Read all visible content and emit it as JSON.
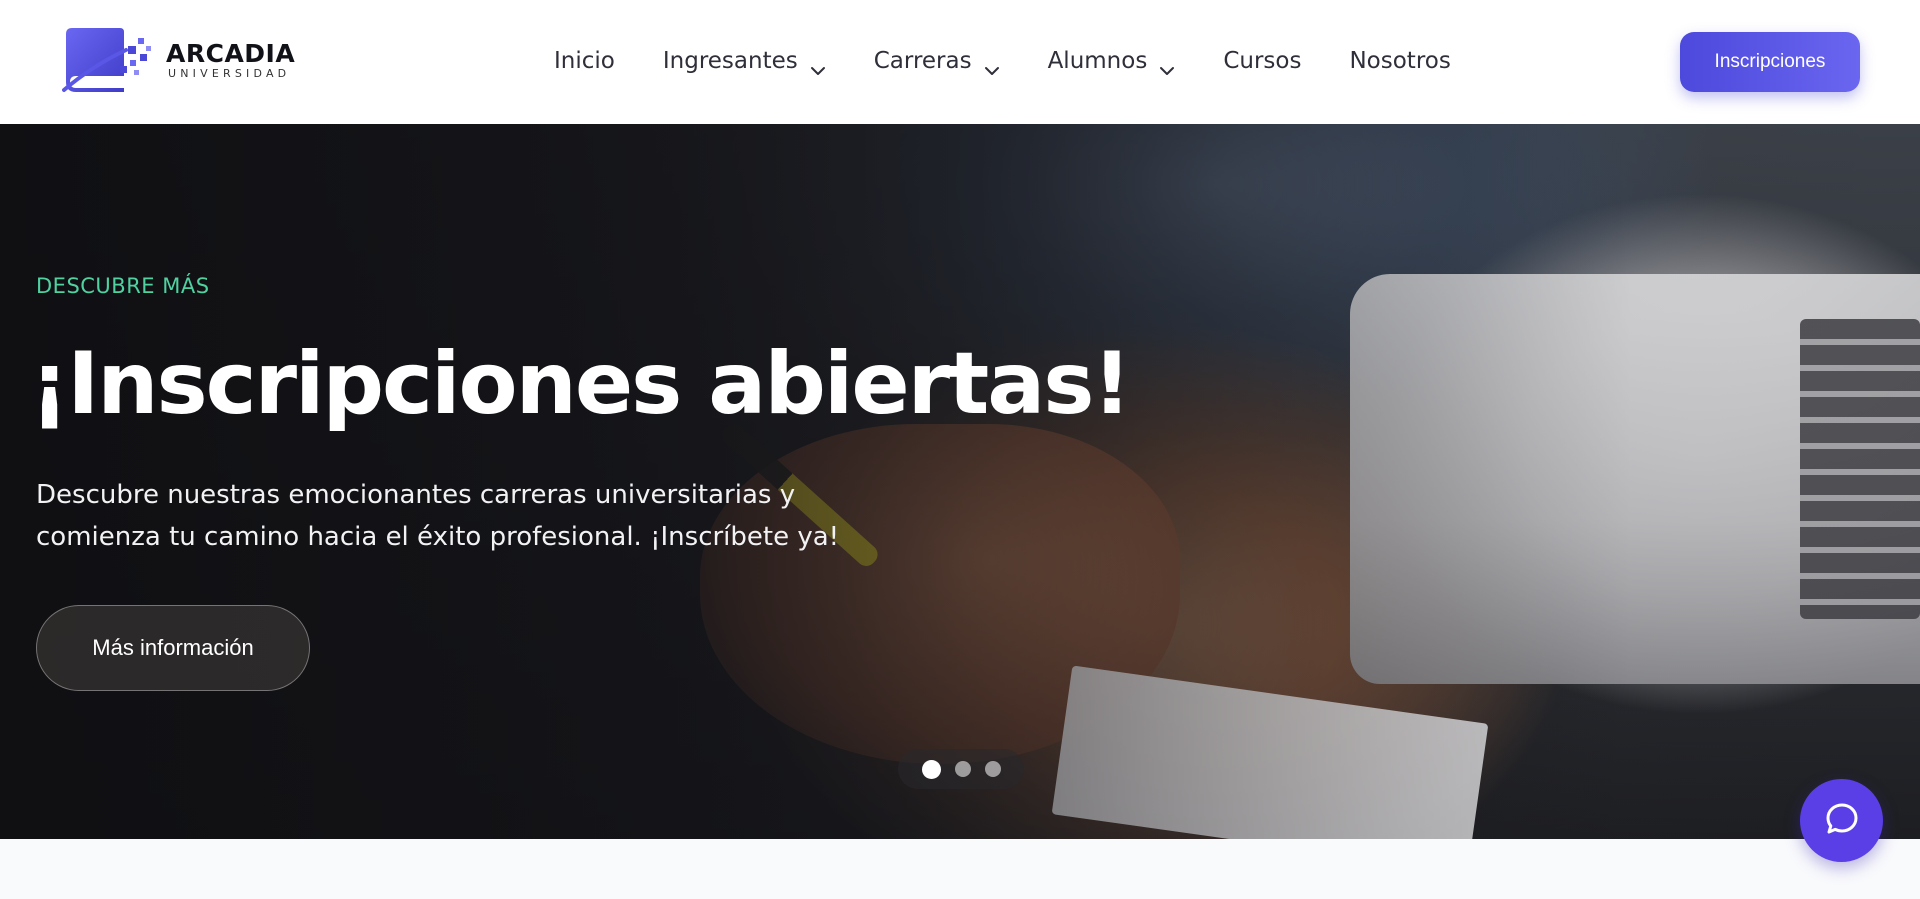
{
  "brand": {
    "name": "ARCADIA",
    "subtitle": "UNIVERSIDAD",
    "logo_icon": "book-pixel-icon",
    "accent_color": "#4f4ce0"
  },
  "nav": {
    "items": [
      {
        "label": "Inicio",
        "has_dropdown": false
      },
      {
        "label": "Ingresantes",
        "has_dropdown": true
      },
      {
        "label": "Carreras",
        "has_dropdown": true
      },
      {
        "label": "Alumnos",
        "has_dropdown": true
      },
      {
        "label": "Cursos",
        "has_dropdown": false
      },
      {
        "label": "Nosotros",
        "has_dropdown": false
      }
    ],
    "cta_label": "Inscripciones"
  },
  "hero": {
    "eyebrow": "DESCUBRE MÁS",
    "eyebrow_color": "#4fd1a0",
    "title": "¡Inscripciones abiertas!",
    "description": "Descubre nuestras emocionantes carreras universitarias y comienza tu camino hacia el éxito profesional. ¡Inscríbete ya!",
    "button_label": "Más información",
    "slides": 3,
    "active_slide": 1
  },
  "chat": {
    "icon": "chat-bubble-icon",
    "color": "#5a3fe6"
  }
}
